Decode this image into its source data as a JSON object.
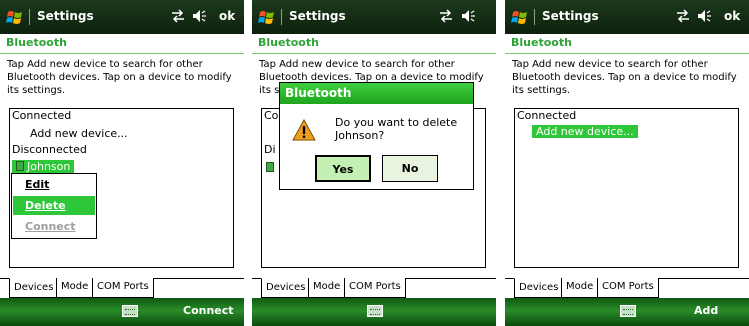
{
  "screens": [
    {
      "title": "Settings",
      "ok": "ok",
      "heading": "Bluetooth",
      "description": "Tap Add new device to search for other Bluetooth devices. Tap on a device to modify its settings.",
      "list": {
        "connected_label": "Connected",
        "add_device": "Add new device...",
        "disconnected_label": "Disconnected",
        "device_name": "Johnson"
      },
      "context_menu": [
        "Edit",
        "Delete",
        "Connect"
      ],
      "tabs": [
        "Devices",
        "Mode",
        "COM Ports"
      ],
      "right_softkey": "Connect"
    },
    {
      "title": "Settings",
      "heading": "Bluetooth",
      "description": "Tap Add new device to search for other Bluetooth devices. Tap on a device to modify its settings.",
      "list_partial": {
        "row1": "Co",
        "row2": "Di"
      },
      "dialog": {
        "title": "Bluetooth",
        "message": "Do you want to delete Johnson?",
        "yes": "Yes",
        "no": "No"
      },
      "tabs": [
        "Devices",
        "Mode",
        "COM Ports"
      ]
    },
    {
      "title": "Settings",
      "ok": "ok",
      "heading": "Bluetooth",
      "description": "Tap Add new device to search for other Bluetooth devices. Tap on a device to modify its settings.",
      "list": {
        "connected_label": "Connected",
        "add_device": "Add new device..."
      },
      "tabs": [
        "Devices",
        "Mode",
        "COM Ports"
      ],
      "right_softkey": "Add"
    }
  ],
  "colors": {
    "titlebar": "#0e200e",
    "accent_green": "#2ec73a",
    "heading_green": "#2ea336",
    "softbar_green": "#2a8c2a"
  },
  "icons": [
    "windows-start-icon",
    "connectivity-icon",
    "volume-icon",
    "keyboard-icon",
    "warning-icon",
    "bluetooth-device-icon"
  ]
}
